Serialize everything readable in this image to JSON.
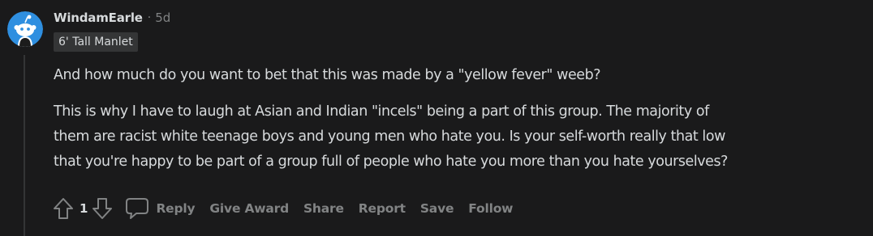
{
  "comment": {
    "author": "WindamEarle",
    "separator": "·",
    "timestamp": "5d",
    "flair": "6' Tall Manlet",
    "body": {
      "paragraph1": "And how much do you want to bet that this was made by a \"yellow fever\" weeb?",
      "paragraph2_lines": [
        "This is why I have to laugh at Asian and Indian \"incels\" being a part of this group. The majority of",
        "them are racist white teenage boys and young men who hate you. Is your self-worth really that low",
        "that you're happy to be part of a group full of people who hate you more than you hate yourselves?"
      ]
    },
    "score": "1",
    "actions": {
      "reply": "Reply",
      "give_award": "Give Award",
      "share": "Share",
      "report": "Report",
      "save": "Save",
      "follow": "Follow"
    },
    "icons": {
      "avatar": "reddit-snoo-avatar",
      "upvote": "arrow-up-icon",
      "downvote": "arrow-down-icon",
      "reply": "speech-bubble-icon"
    },
    "colors": {
      "background": "#1a1a1b",
      "text": "#d7dadc",
      "muted": "#818384",
      "flair_bg": "#343536",
      "avatar_bg": "#2f8fe0"
    }
  }
}
